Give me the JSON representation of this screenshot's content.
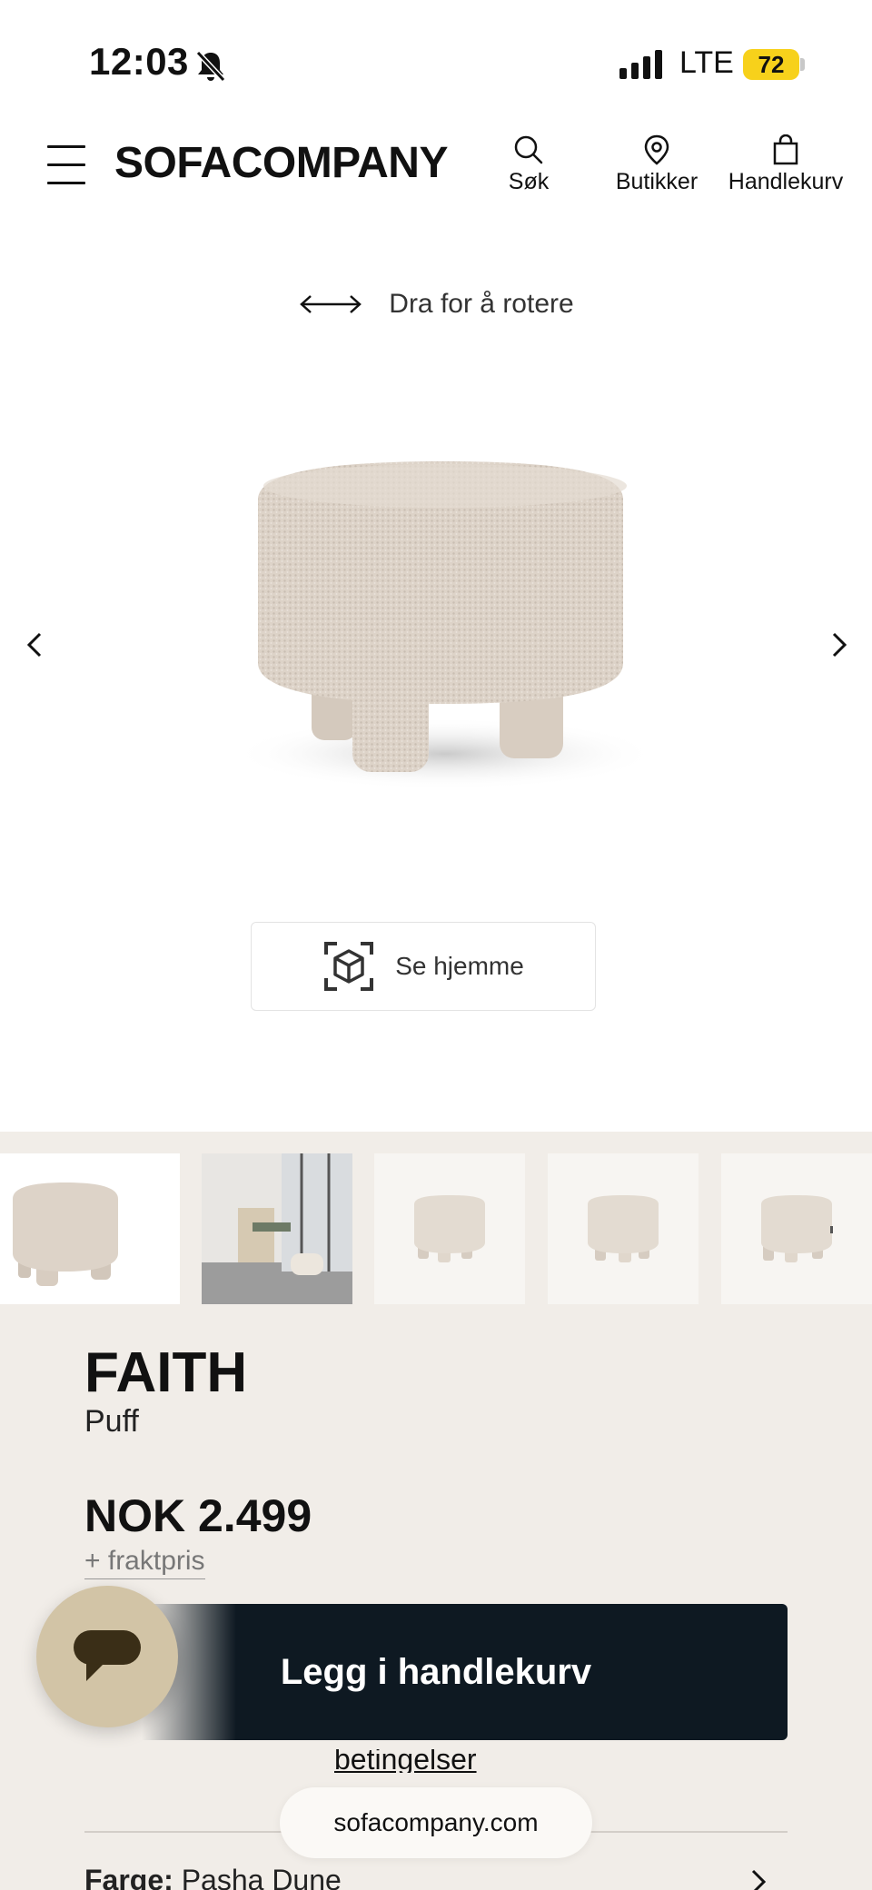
{
  "status_bar": {
    "time": "12:03",
    "network": "LTE",
    "battery": "72"
  },
  "header": {
    "logo": "SOFACOMPANY",
    "nav": {
      "search": "Søk",
      "stores": "Butikker",
      "cart": "Handlekurv"
    }
  },
  "viewer": {
    "rotate_hint": "Dra for å rotere",
    "ar_button": "Se hjemme"
  },
  "product": {
    "name": "FAITH",
    "type": "Puff",
    "price": "NOK 2.499",
    "shipping": "+ fraktpris",
    "add_to_cart": "Legg i handlekurv",
    "terms_link": "betingelser",
    "color_label": "Farge:",
    "color_value": "Pasha Dune"
  },
  "browser": {
    "url": "sofacompany.com"
  },
  "icons": {
    "menu": "hamburger-menu-icon",
    "search": "search-icon",
    "stores": "location-pin-icon",
    "cart": "shopping-bag-icon",
    "rotate": "double-arrow-icon",
    "ar": "ar-cube-icon",
    "chat": "chat-bubble-icon"
  },
  "colors": {
    "cart_button": "#0e1922",
    "panel_bg": "#f1ede8",
    "chat_button": "#d2c4a6",
    "battery": "#f7d11b",
    "product_fabric": "#ddd3c8"
  }
}
